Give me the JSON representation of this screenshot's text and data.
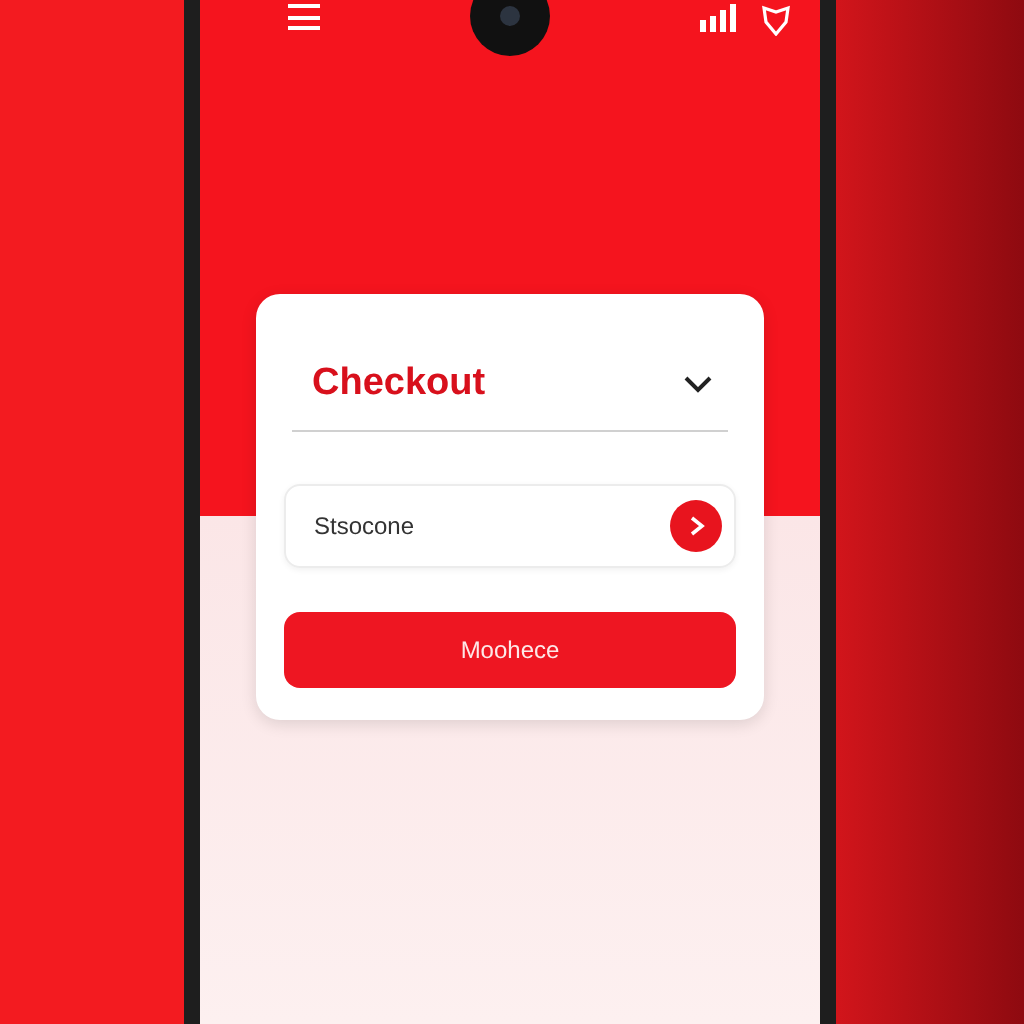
{
  "card": {
    "title": "Checkout",
    "field": {
      "value": "Stsocone"
    },
    "button": {
      "label": "Moohece"
    }
  }
}
